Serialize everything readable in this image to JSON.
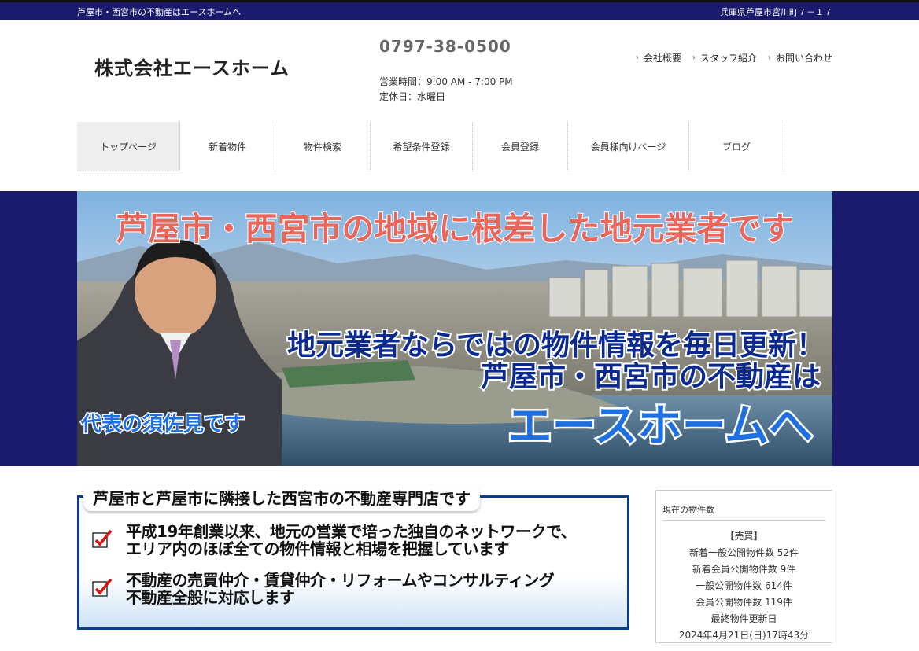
{
  "topbar": {
    "tagline": "芦屋市・西宮市の不動産はエースホームへ",
    "address": "兵庫県芦屋市宮川町７－１７"
  },
  "header": {
    "company_name": "株式会社エースホーム",
    "phone": "0797-38-0500",
    "hours": "営業時間：9:00 AM - 7:00 PM",
    "closed": "定休日：水曜日"
  },
  "util_nav": [
    {
      "label": "会社概要"
    },
    {
      "label": "スタッフ紹介"
    },
    {
      "label": "お問い合わせ"
    }
  ],
  "global_nav": [
    {
      "label": "トップページ",
      "active": true
    },
    {
      "label": "新着物件"
    },
    {
      "label": "物件検索"
    },
    {
      "label": "希望条件登録"
    },
    {
      "label": "会員登録"
    },
    {
      "label": "会員様向けページ"
    },
    {
      "label": "ブログ"
    }
  ],
  "hero": {
    "headline": "芦屋市・西宮市の地域に根差した地元業者です",
    "line1": "地元業者ならではの物件情報を毎日更新！",
    "line2": "芦屋市・西宮市の不動産は",
    "line3": "エースホームへ",
    "caption": "代表の須佐見です"
  },
  "intro": {
    "title": "芦屋市と芦屋市に隣接した西宮市の不動産専門店です",
    "points": [
      {
        "line1": "平成19年創業以来、地元の営業で培った独自のネットワークで、",
        "line2": "エリア内のほぼ全ての物件情報と相場を把握しています"
      },
      {
        "line1": "不動産の売買仲介・賃貸仲介・リフォームやコンサルティング",
        "line2": "不動産全般に対応します"
      }
    ]
  },
  "stock": {
    "heading": "現在の物件数",
    "lines": [
      "【売買】",
      "新着一般公開物件数 52件",
      "新着会員公開物件数 9件",
      "一般公開物件数 614件",
      "会員公開物件数 119件",
      "最終物件更新日",
      "2024年4月21日(日)17時43分"
    ]
  },
  "colors": {
    "navy": "#1a1a6e",
    "hero_headline": "#e8665a",
    "hero_blue": "#0a2a8f",
    "hero_accent": "#1e6fe0",
    "checkbox_red": "#d11"
  }
}
